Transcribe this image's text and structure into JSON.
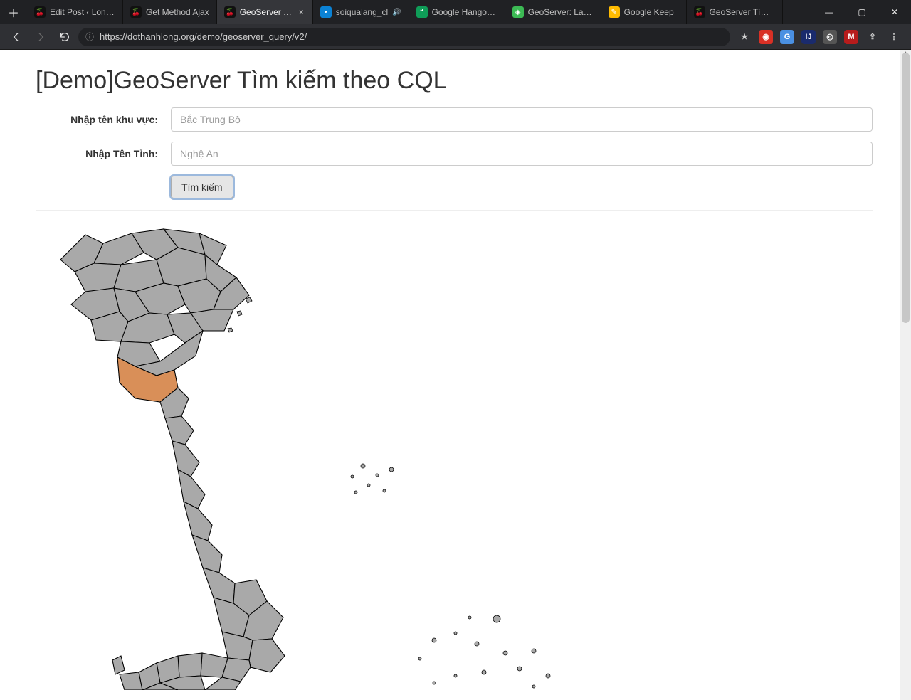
{
  "titlebar": {
    "newtab_glyph": "＋",
    "tabs": [
      {
        "label": "Edit Post ‹ Long's",
        "favicon_bg": "#111",
        "favicon_glyph": "🍒"
      },
      {
        "label": "Get Method Ajax",
        "favicon_bg": "#111",
        "favicon_glyph": "🍒"
      },
      {
        "label": "GeoServer Tìm",
        "favicon_bg": "#111",
        "favicon_glyph": "🍒",
        "active": true,
        "closable": true
      },
      {
        "label": "soiqualang_cl",
        "favicon_bg": "#0b82d4",
        "favicon_glyph": "•",
        "audio": true
      },
      {
        "label": "Google Hangouts",
        "favicon_bg": "#0f9d58",
        "favicon_glyph": "❝"
      },
      {
        "label": "GeoServer: Layers",
        "favicon_bg": "#3cba54",
        "favicon_glyph": "◈"
      },
      {
        "label": "Google Keep",
        "favicon_bg": "#ffbb00",
        "favicon_glyph": "✎"
      },
      {
        "label": "GeoServer Tìm ki",
        "favicon_bg": "#111",
        "favicon_glyph": "🍒"
      }
    ],
    "win_min": "—",
    "win_max": "▢",
    "win_close": "✕"
  },
  "addressbar": {
    "url_prefix": "ⓘ",
    "url_text": "https://dothanhlong.org/demo/geoserver_query/v2/",
    "ext_icons": [
      {
        "glyph": "★",
        "bg": "transparent",
        "color": "#cfcfcf"
      },
      {
        "glyph": "◉",
        "bg": "#d93025",
        "color": "#fff"
      },
      {
        "glyph": "G",
        "bg": "#4a90e2",
        "color": "#fff"
      },
      {
        "glyph": "IJ",
        "bg": "#1a2b6d",
        "color": "#fff"
      },
      {
        "glyph": "◎",
        "bg": "#555",
        "color": "#fff"
      },
      {
        "glyph": "M",
        "bg": "#b71c1c",
        "color": "#fff"
      },
      {
        "glyph": "⇪",
        "bg": "transparent",
        "color": "#cfcfcf"
      },
      {
        "glyph": "⋮",
        "bg": "transparent",
        "color": "#cfcfcf"
      }
    ]
  },
  "page": {
    "title": "[Demo]GeoServer Tìm kiếm theo CQL",
    "label_area": "Nhập tên khu vực:",
    "placeholder_area": "Bắc Trung Bộ",
    "label_province": "Nhập Tên Tỉnh:",
    "placeholder_province": "Nghệ An",
    "btn_search": "Tìm kiếm"
  }
}
